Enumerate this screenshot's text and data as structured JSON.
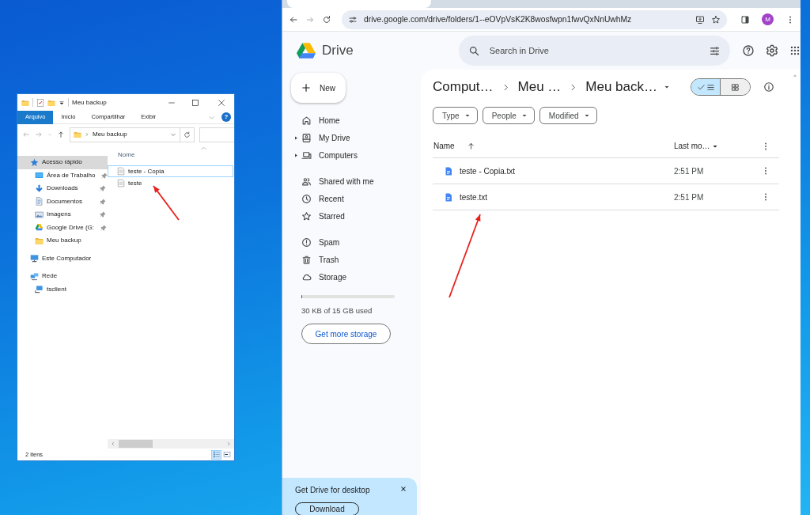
{
  "explorer": {
    "title": "Meu backup",
    "ribbon_tabs": [
      {
        "label": "Arquivo",
        "selected": true
      },
      {
        "label": "Início",
        "selected": false
      },
      {
        "label": "Compartilhar",
        "selected": false
      },
      {
        "label": "Exibir",
        "selected": false
      }
    ],
    "help": "?",
    "address": "Meu backup",
    "column_header": "Nome",
    "nav": [
      {
        "label": "Acesso rápido",
        "kind": "star",
        "selected": true,
        "children": [
          {
            "label": "Área de Trabalho",
            "kind": "desktop",
            "pinned": true,
            "selected": false
          },
          {
            "label": "Downloads",
            "kind": "download",
            "pinned": true,
            "selected": false
          },
          {
            "label": "Documentos",
            "kind": "document",
            "pinned": true,
            "selected": false
          },
          {
            "label": "Imagens",
            "kind": "pictures",
            "pinned": true,
            "selected": false
          },
          {
            "label": "Google Drive (G:",
            "kind": "drive",
            "pinned": true,
            "selected": false
          },
          {
            "label": "Meu backup",
            "kind": "folder",
            "pinned": false,
            "selected": false
          }
        ]
      },
      {
        "label": "Este Computador",
        "kind": "computer",
        "selected": false
      },
      {
        "label": "Rede",
        "kind": "network",
        "selected": false,
        "children": [
          {
            "label": "tsclient",
            "kind": "share",
            "pinned": false,
            "selected": false
          }
        ]
      }
    ],
    "files": [
      {
        "name": "teste - Copia",
        "focused": true
      },
      {
        "name": "teste",
        "focused": false
      }
    ],
    "status": "2 itens",
    "views": [
      {
        "kind": "details",
        "selected": true
      },
      {
        "kind": "tiles",
        "selected": false
      }
    ]
  },
  "browser": {
    "url": "drive.google.com/drive/folders/1--eOVpVsK2K8wosfwpn1fwvQxNnUwhMz",
    "profile": "M"
  },
  "drive": {
    "logo": "Drive",
    "search": {
      "placeholder": "Search in Drive"
    },
    "new_label": "New",
    "nav_sections": [
      {
        "items": [
          {
            "label": "Home",
            "kind": "home",
            "expandable": false
          },
          {
            "label": "My Drive",
            "kind": "my-drive",
            "expandable": true
          },
          {
            "label": "Computers",
            "kind": "computers",
            "expandable": true
          }
        ]
      },
      {
        "items": [
          {
            "label": "Shared with me",
            "kind": "shared",
            "expandable": false
          },
          {
            "label": "Recent",
            "kind": "recent",
            "expandable": false
          },
          {
            "label": "Starred",
            "kind": "starred",
            "expandable": false
          }
        ]
      },
      {
        "items": [
          {
            "label": "Spam",
            "kind": "spam",
            "expandable": false
          },
          {
            "label": "Trash",
            "kind": "trash",
            "expandable": false
          },
          {
            "label": "Storage",
            "kind": "storage",
            "expandable": false
          }
        ]
      }
    ],
    "storage": {
      "level": 0.01,
      "text": "30 KB of 15 GB used",
      "button": "Get more storage"
    },
    "breadcrumbs": [
      {
        "label": "Comput…",
        "menu": false
      },
      {
        "label": "Meu …",
        "menu": false
      },
      {
        "label": "Meu back…",
        "menu": true
      }
    ],
    "view_toggle": [
      {
        "kind": "list",
        "selected": true
      },
      {
        "kind": "grid",
        "selected": false
      }
    ],
    "filters": [
      "Type",
      "People",
      "Modified"
    ],
    "columns": {
      "name": "Name",
      "modified": "Last mo…"
    },
    "files": [
      {
        "name": "teste - Copia.txt",
        "modified": "2:51 PM"
      },
      {
        "name": "teste.txt",
        "modified": "2:51 PM"
      }
    ],
    "banner": {
      "title": "Get Drive for desktop",
      "button": "Download"
    }
  }
}
